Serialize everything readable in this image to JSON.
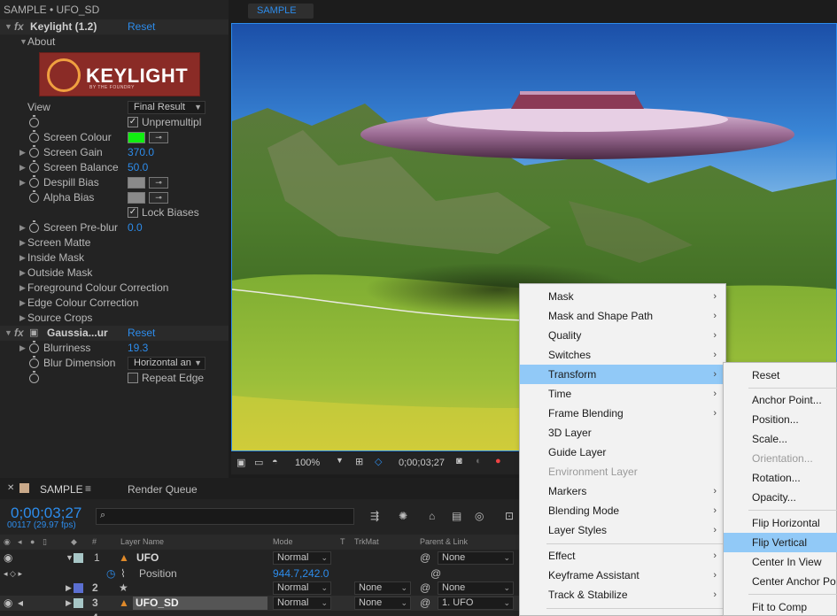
{
  "effect_controls": {
    "title": "SAMPLE • UFO_SD",
    "keylight": {
      "name": "Keylight (1.2)",
      "reset": "Reset",
      "about": "About",
      "logo_text": "KEYLIGHT",
      "logo_sub": "BY THE FOUNDRY",
      "view_label": "View",
      "view_value": "Final Result",
      "unpremultiply": "Unpremultipl",
      "screen_colour": "Screen Colour",
      "screen_colour_value": "#11ee11",
      "screen_gain": "Screen Gain",
      "screen_gain_value": "370.0",
      "screen_balance": "Screen Balance",
      "screen_balance_value": "50.0",
      "despill_bias": "Despill Bias",
      "alpha_bias": "Alpha Bias",
      "lock_biases": "Lock Biases",
      "screen_preblur": "Screen Pre-blur",
      "screen_preblur_value": "0.0",
      "groups": [
        "Screen Matte",
        "Inside Mask",
        "Outside Mask",
        "Foreground Colour Correction",
        "Edge Colour Correction",
        "Source Crops"
      ]
    },
    "gaussian": {
      "name": "Gaussia...ur",
      "reset": "Reset",
      "blurriness": "Blurriness",
      "blurriness_value": "19.3",
      "blur_dimension": "Blur Dimension",
      "blur_dimension_value": "Horizontal an",
      "repeat_edge": "Repeat Edge"
    }
  },
  "composition": {
    "tab": "SAMPLE",
    "zoom": "100%",
    "timecode": "0;00;03;27"
  },
  "timeline": {
    "tab": "SAMPLE",
    "render_queue": "Render Queue",
    "timecode": "0;00;03;27",
    "frame_info": "00117 (29.97 fps)",
    "search_placeholder": "",
    "headers": {
      "layer_name": "Layer Name",
      "mode": "Mode",
      "t": "T",
      "trkmat": "TrkMat",
      "parent": "Parent & Link"
    },
    "layers": [
      {
        "num": "1",
        "name": "UFO",
        "mode": "Normal",
        "trkmat": "",
        "parent": "None"
      },
      {
        "prop": "Position",
        "value": "944.7,242.0"
      },
      {
        "num": "2",
        "name": "",
        "mode": "Normal",
        "trkmat": "None",
        "parent": "None"
      },
      {
        "num": "3",
        "name": "UFO_SD",
        "mode": "Normal",
        "trkmat": "None",
        "parent": "1. UFO"
      },
      {
        "num": "4",
        "name": "",
        "mode": "",
        "trkmat": "",
        "parent": ""
      }
    ]
  },
  "context_menu": {
    "items": [
      "Mask",
      "Mask and Shape Path",
      "Quality",
      "Switches",
      "Transform",
      "Time",
      "Frame Blending",
      "3D Layer",
      "Guide Layer",
      "Environment Layer",
      "Markers",
      "Blending Mode",
      "Layer Styles",
      "Effect",
      "Keyframe Assistant",
      "Track & Stabilize"
    ],
    "highlighted": "Transform"
  },
  "submenu": {
    "items": [
      "Reset",
      "Anchor Point...",
      "Position...",
      "Scale...",
      "Orientation...",
      "Rotation...",
      "Opacity...",
      "Flip Horizontal",
      "Flip Vertical",
      "Center In View",
      "Center Anchor Po",
      "Fit to Comp"
    ],
    "highlighted": "Flip Vertical"
  }
}
